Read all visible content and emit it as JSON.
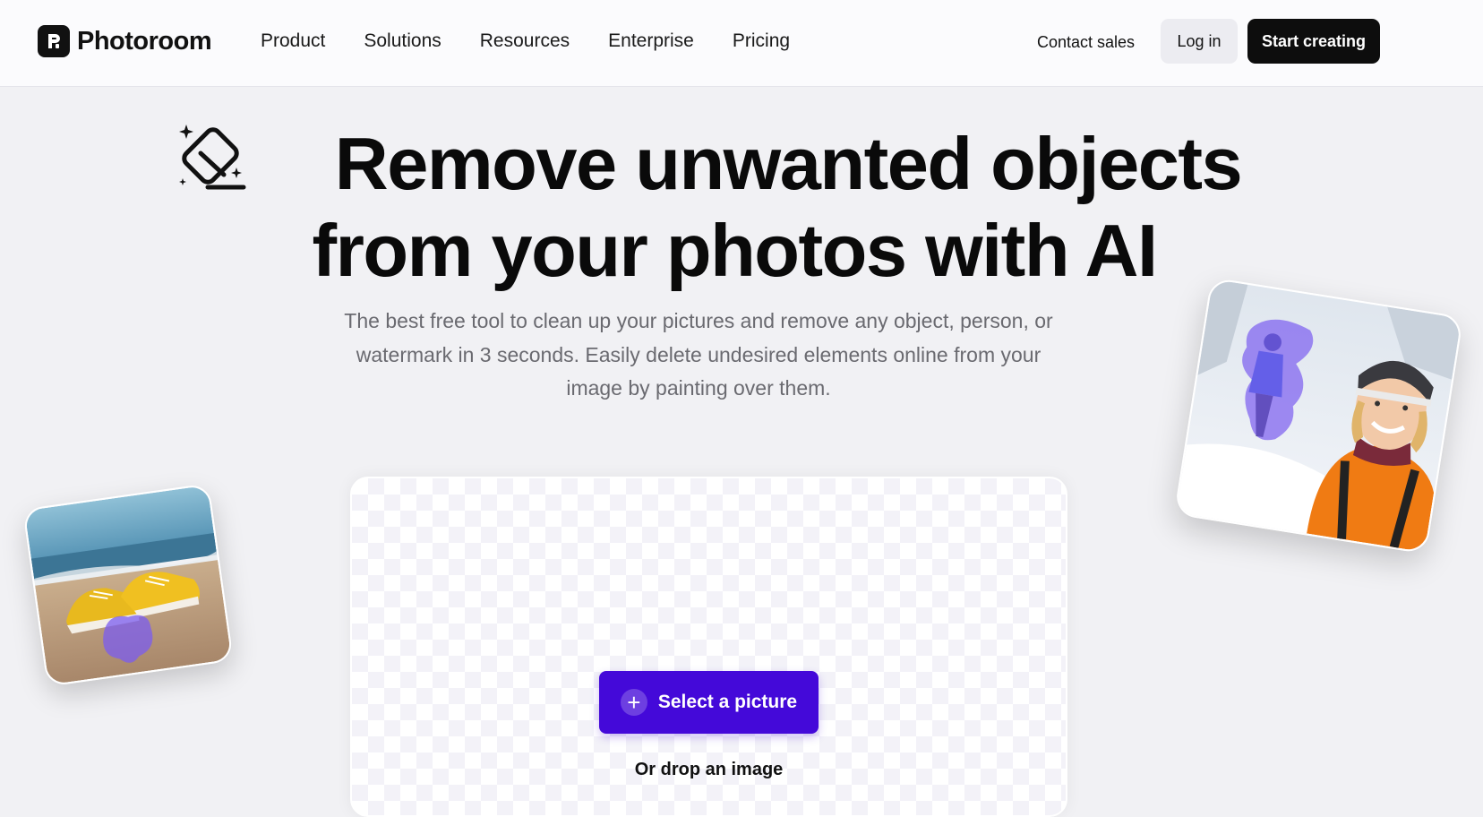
{
  "brand": {
    "name": "Photoroom"
  },
  "nav": {
    "items": [
      {
        "label": "Product"
      },
      {
        "label": "Solutions"
      },
      {
        "label": "Resources"
      },
      {
        "label": "Enterprise"
      },
      {
        "label": "Pricing"
      }
    ],
    "contact_label": "Contact sales",
    "login_label": "Log in",
    "start_label": "Start creating"
  },
  "hero": {
    "title_line1": "Remove unwanted objects",
    "title_line2": "from your photos with AI",
    "subtitle": "The best free tool to clean up your pictures and remove any object, person, or watermark in 3 seconds. Easily delete undesired elements online from your image by painting over them.",
    "icon": "eraser-sparkle-icon"
  },
  "uploader": {
    "select_label": "Select a picture",
    "drop_label": "Or drop an image"
  },
  "colors": {
    "accent": "#4409d9",
    "background": "#f1f1f4",
    "brush_overlay": "#7b5cf0"
  }
}
